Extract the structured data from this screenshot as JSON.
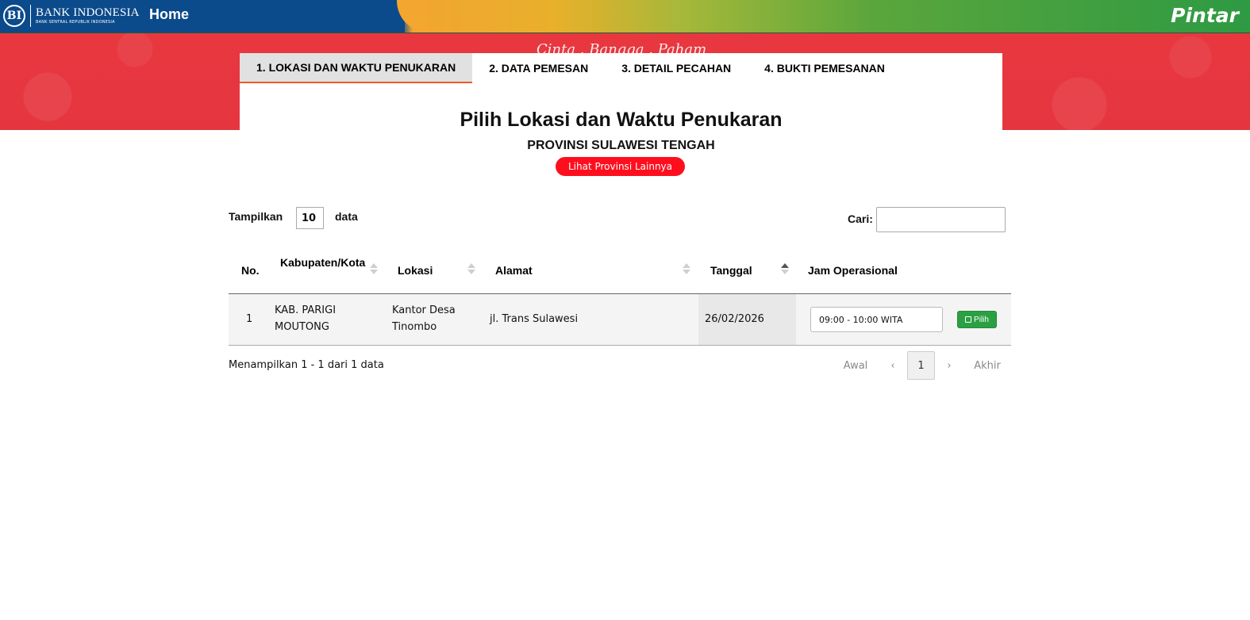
{
  "navbar": {
    "logo_text": "BANK INDONESIA",
    "logo_subtext": "BANK SENTRAL REPUBLIK INDONESIA",
    "logo_emblem": "BI",
    "home_label": "Home",
    "brand": "Pintar"
  },
  "banner": {
    "motto": "Cinta . Bangga . Paham"
  },
  "tabs": [
    {
      "label": "1. LOKASI DAN WAKTU PENUKARAN",
      "active": true
    },
    {
      "label": "2. DATA PEMESAN"
    },
    {
      "label": "3. DETAIL PECAHAN"
    },
    {
      "label": "4. BUKTI PEMESANAN"
    }
  ],
  "page": {
    "title": "Pilih Lokasi dan Waktu Penukaran",
    "province": "PROVINSI SULAWESI TENGAH",
    "other_province_button": "Lihat Provinsi Lainnya"
  },
  "table_controls": {
    "show_label": "Tampilkan",
    "show_value": "10",
    "data_label": "data",
    "search_label": "Cari:",
    "search_value": ""
  },
  "table": {
    "headers": {
      "no": "No.",
      "kabupaten": "Kabupaten/Kota",
      "lokasi": "Lokasi",
      "alamat": "Alamat",
      "tanggal": "Tanggal",
      "jam": "Jam Operasional"
    },
    "rows": [
      {
        "no": "1",
        "kabupaten": "KAB. PARIGI MOUTONG",
        "lokasi": "Kantor Desa Tinombo",
        "alamat": "jl. Trans Sulawesi",
        "tanggal": "26/02/2026",
        "jam": "09:00 - 10:00 WITA",
        "action": "Pilih"
      }
    ]
  },
  "footer": {
    "info": "Menampilkan 1 - 1 dari 1 data",
    "pagination": {
      "first": "Awal",
      "prev": "‹",
      "current": "1",
      "next": "›",
      "last": "Akhir"
    }
  },
  "colors": {
    "navbar_blue": "#0b4a8b",
    "banner_red": "#e8373f",
    "active_tab_border": "#ee5a2a",
    "province_button": "#ff0f1e",
    "pilih_button": "#2aa043"
  }
}
